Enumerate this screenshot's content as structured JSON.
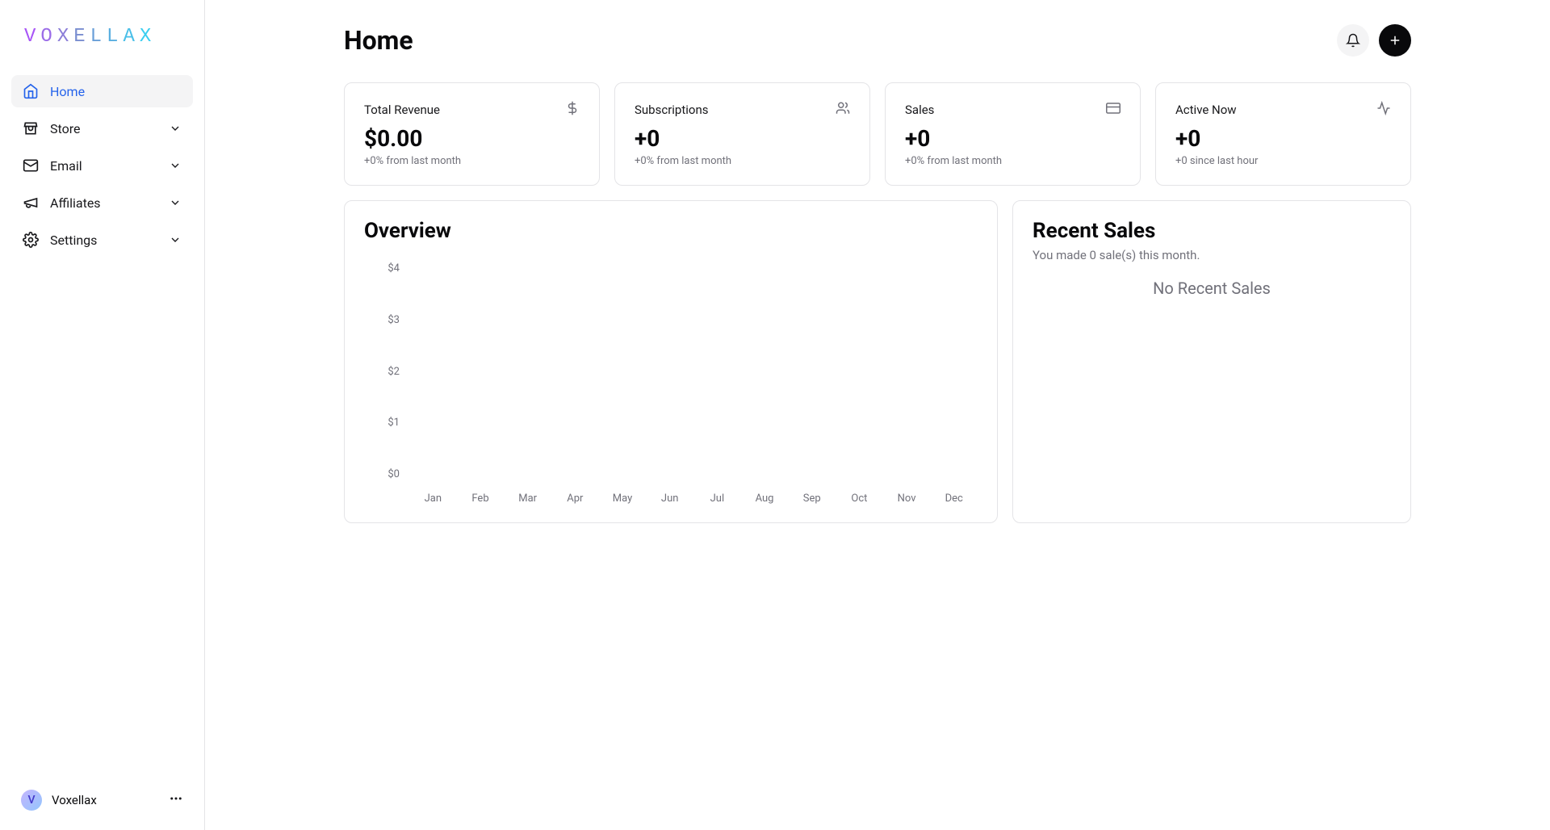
{
  "brand": "VOXELLAX",
  "sidebar": {
    "items": [
      {
        "label": "Home",
        "icon": "home",
        "active": true,
        "expandable": false
      },
      {
        "label": "Store",
        "icon": "store",
        "active": false,
        "expandable": true
      },
      {
        "label": "Email",
        "icon": "mail",
        "active": false,
        "expandable": true
      },
      {
        "label": "Affiliates",
        "icon": "megaphone",
        "active": false,
        "expandable": true
      },
      {
        "label": "Settings",
        "icon": "gear",
        "active": false,
        "expandable": true
      }
    ],
    "footer": {
      "name": "Voxellax",
      "initial": "V"
    }
  },
  "page": {
    "title": "Home"
  },
  "stats": [
    {
      "label": "Total Revenue",
      "value": "$0.00",
      "sub": "+0% from last month",
      "icon": "dollar"
    },
    {
      "label": "Subscriptions",
      "value": "+0",
      "sub": "+0% from last month",
      "icon": "users"
    },
    {
      "label": "Sales",
      "value": "+0",
      "sub": "+0% from last month",
      "icon": "card"
    },
    {
      "label": "Active Now",
      "value": "+0",
      "sub": "+0 since last hour",
      "icon": "activity"
    }
  ],
  "overview": {
    "title": "Overview"
  },
  "recent": {
    "title": "Recent Sales",
    "subtitle": "You made 0 sale(s) this month.",
    "empty": "No Recent Sales"
  },
  "chart_data": {
    "type": "bar",
    "categories": [
      "Jan",
      "Feb",
      "Mar",
      "Apr",
      "May",
      "Jun",
      "Jul",
      "Aug",
      "Sep",
      "Oct",
      "Nov",
      "Dec"
    ],
    "values": [
      0,
      0,
      0,
      0,
      0,
      0,
      0,
      0,
      0,
      0,
      0,
      0
    ],
    "y_ticks": [
      "$4",
      "$3",
      "$2",
      "$1",
      "$0"
    ],
    "title": "Overview",
    "xlabel": "",
    "ylabel": "",
    "ylim": [
      0,
      4
    ]
  }
}
